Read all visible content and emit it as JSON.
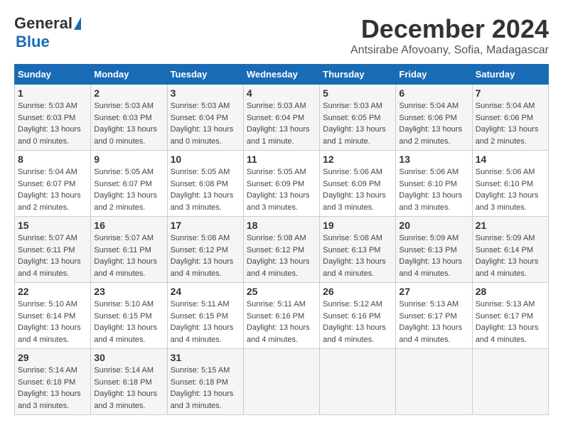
{
  "logo": {
    "general": "General",
    "blue": "Blue"
  },
  "title": "December 2024",
  "subtitle": "Antsirabe Afovoany, Sofia, Madagascar",
  "days_header": [
    "Sunday",
    "Monday",
    "Tuesday",
    "Wednesday",
    "Thursday",
    "Friday",
    "Saturday"
  ],
  "weeks": [
    [
      {
        "day": "1",
        "sunrise": "Sunrise: 5:03 AM",
        "sunset": "Sunset: 6:03 PM",
        "daylight": "Daylight: 13 hours and 0 minutes."
      },
      {
        "day": "2",
        "sunrise": "Sunrise: 5:03 AM",
        "sunset": "Sunset: 6:03 PM",
        "daylight": "Daylight: 13 hours and 0 minutes."
      },
      {
        "day": "3",
        "sunrise": "Sunrise: 5:03 AM",
        "sunset": "Sunset: 6:04 PM",
        "daylight": "Daylight: 13 hours and 0 minutes."
      },
      {
        "day": "4",
        "sunrise": "Sunrise: 5:03 AM",
        "sunset": "Sunset: 6:04 PM",
        "daylight": "Daylight: 13 hours and 1 minute."
      },
      {
        "day": "5",
        "sunrise": "Sunrise: 5:03 AM",
        "sunset": "Sunset: 6:05 PM",
        "daylight": "Daylight: 13 hours and 1 minute."
      },
      {
        "day": "6",
        "sunrise": "Sunrise: 5:04 AM",
        "sunset": "Sunset: 6:06 PM",
        "daylight": "Daylight: 13 hours and 2 minutes."
      },
      {
        "day": "7",
        "sunrise": "Sunrise: 5:04 AM",
        "sunset": "Sunset: 6:06 PM",
        "daylight": "Daylight: 13 hours and 2 minutes."
      }
    ],
    [
      {
        "day": "8",
        "sunrise": "Sunrise: 5:04 AM",
        "sunset": "Sunset: 6:07 PM",
        "daylight": "Daylight: 13 hours and 2 minutes."
      },
      {
        "day": "9",
        "sunrise": "Sunrise: 5:05 AM",
        "sunset": "Sunset: 6:07 PM",
        "daylight": "Daylight: 13 hours and 2 minutes."
      },
      {
        "day": "10",
        "sunrise": "Sunrise: 5:05 AM",
        "sunset": "Sunset: 6:08 PM",
        "daylight": "Daylight: 13 hours and 3 minutes."
      },
      {
        "day": "11",
        "sunrise": "Sunrise: 5:05 AM",
        "sunset": "Sunset: 6:09 PM",
        "daylight": "Daylight: 13 hours and 3 minutes."
      },
      {
        "day": "12",
        "sunrise": "Sunrise: 5:06 AM",
        "sunset": "Sunset: 6:09 PM",
        "daylight": "Daylight: 13 hours and 3 minutes."
      },
      {
        "day": "13",
        "sunrise": "Sunrise: 5:06 AM",
        "sunset": "Sunset: 6:10 PM",
        "daylight": "Daylight: 13 hours and 3 minutes."
      },
      {
        "day": "14",
        "sunrise": "Sunrise: 5:06 AM",
        "sunset": "Sunset: 6:10 PM",
        "daylight": "Daylight: 13 hours and 3 minutes."
      }
    ],
    [
      {
        "day": "15",
        "sunrise": "Sunrise: 5:07 AM",
        "sunset": "Sunset: 6:11 PM",
        "daylight": "Daylight: 13 hours and 4 minutes."
      },
      {
        "day": "16",
        "sunrise": "Sunrise: 5:07 AM",
        "sunset": "Sunset: 6:11 PM",
        "daylight": "Daylight: 13 hours and 4 minutes."
      },
      {
        "day": "17",
        "sunrise": "Sunrise: 5:08 AM",
        "sunset": "Sunset: 6:12 PM",
        "daylight": "Daylight: 13 hours and 4 minutes."
      },
      {
        "day": "18",
        "sunrise": "Sunrise: 5:08 AM",
        "sunset": "Sunset: 6:12 PM",
        "daylight": "Daylight: 13 hours and 4 minutes."
      },
      {
        "day": "19",
        "sunrise": "Sunrise: 5:08 AM",
        "sunset": "Sunset: 6:13 PM",
        "daylight": "Daylight: 13 hours and 4 minutes."
      },
      {
        "day": "20",
        "sunrise": "Sunrise: 5:09 AM",
        "sunset": "Sunset: 6:13 PM",
        "daylight": "Daylight: 13 hours and 4 minutes."
      },
      {
        "day": "21",
        "sunrise": "Sunrise: 5:09 AM",
        "sunset": "Sunset: 6:14 PM",
        "daylight": "Daylight: 13 hours and 4 minutes."
      }
    ],
    [
      {
        "day": "22",
        "sunrise": "Sunrise: 5:10 AM",
        "sunset": "Sunset: 6:14 PM",
        "daylight": "Daylight: 13 hours and 4 minutes."
      },
      {
        "day": "23",
        "sunrise": "Sunrise: 5:10 AM",
        "sunset": "Sunset: 6:15 PM",
        "daylight": "Daylight: 13 hours and 4 minutes."
      },
      {
        "day": "24",
        "sunrise": "Sunrise: 5:11 AM",
        "sunset": "Sunset: 6:15 PM",
        "daylight": "Daylight: 13 hours and 4 minutes."
      },
      {
        "day": "25",
        "sunrise": "Sunrise: 5:11 AM",
        "sunset": "Sunset: 6:16 PM",
        "daylight": "Daylight: 13 hours and 4 minutes."
      },
      {
        "day": "26",
        "sunrise": "Sunrise: 5:12 AM",
        "sunset": "Sunset: 6:16 PM",
        "daylight": "Daylight: 13 hours and 4 minutes."
      },
      {
        "day": "27",
        "sunrise": "Sunrise: 5:13 AM",
        "sunset": "Sunset: 6:17 PM",
        "daylight": "Daylight: 13 hours and 4 minutes."
      },
      {
        "day": "28",
        "sunrise": "Sunrise: 5:13 AM",
        "sunset": "Sunset: 6:17 PM",
        "daylight": "Daylight: 13 hours and 4 minutes."
      }
    ],
    [
      {
        "day": "29",
        "sunrise": "Sunrise: 5:14 AM",
        "sunset": "Sunset: 6:18 PM",
        "daylight": "Daylight: 13 hours and 3 minutes."
      },
      {
        "day": "30",
        "sunrise": "Sunrise: 5:14 AM",
        "sunset": "Sunset: 6:18 PM",
        "daylight": "Daylight: 13 hours and 3 minutes."
      },
      {
        "day": "31",
        "sunrise": "Sunrise: 5:15 AM",
        "sunset": "Sunset: 6:18 PM",
        "daylight": "Daylight: 13 hours and 3 minutes."
      },
      null,
      null,
      null,
      null
    ]
  ]
}
